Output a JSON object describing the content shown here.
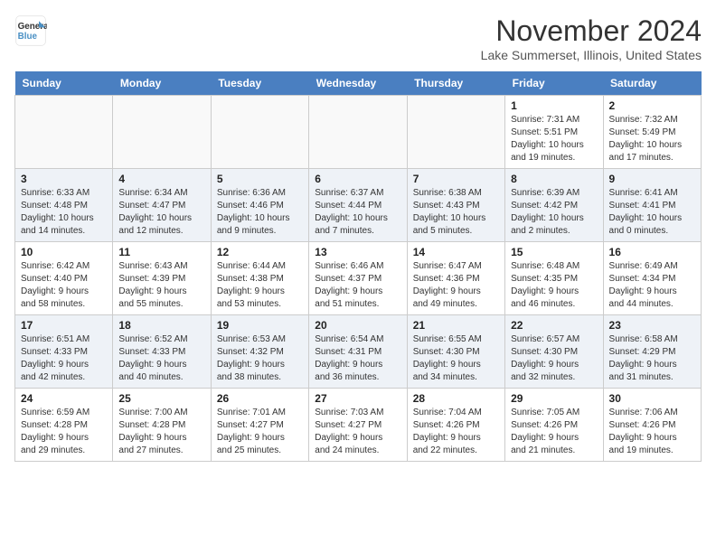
{
  "header": {
    "logo_line1": "General",
    "logo_line2": "Blue",
    "month_title": "November 2024",
    "location": "Lake Summerset, Illinois, United States"
  },
  "weekdays": [
    "Sunday",
    "Monday",
    "Tuesday",
    "Wednesday",
    "Thursday",
    "Friday",
    "Saturday"
  ],
  "weeks": [
    [
      {
        "day": "",
        "info": ""
      },
      {
        "day": "",
        "info": ""
      },
      {
        "day": "",
        "info": ""
      },
      {
        "day": "",
        "info": ""
      },
      {
        "day": "",
        "info": ""
      },
      {
        "day": "1",
        "info": "Sunrise: 7:31 AM\nSunset: 5:51 PM\nDaylight: 10 hours\nand 19 minutes."
      },
      {
        "day": "2",
        "info": "Sunrise: 7:32 AM\nSunset: 5:49 PM\nDaylight: 10 hours\nand 17 minutes."
      }
    ],
    [
      {
        "day": "3",
        "info": "Sunrise: 6:33 AM\nSunset: 4:48 PM\nDaylight: 10 hours\nand 14 minutes."
      },
      {
        "day": "4",
        "info": "Sunrise: 6:34 AM\nSunset: 4:47 PM\nDaylight: 10 hours\nand 12 minutes."
      },
      {
        "day": "5",
        "info": "Sunrise: 6:36 AM\nSunset: 4:46 PM\nDaylight: 10 hours\nand 9 minutes."
      },
      {
        "day": "6",
        "info": "Sunrise: 6:37 AM\nSunset: 4:44 PM\nDaylight: 10 hours\nand 7 minutes."
      },
      {
        "day": "7",
        "info": "Sunrise: 6:38 AM\nSunset: 4:43 PM\nDaylight: 10 hours\nand 5 minutes."
      },
      {
        "day": "8",
        "info": "Sunrise: 6:39 AM\nSunset: 4:42 PM\nDaylight: 10 hours\nand 2 minutes."
      },
      {
        "day": "9",
        "info": "Sunrise: 6:41 AM\nSunset: 4:41 PM\nDaylight: 10 hours\nand 0 minutes."
      }
    ],
    [
      {
        "day": "10",
        "info": "Sunrise: 6:42 AM\nSunset: 4:40 PM\nDaylight: 9 hours\nand 58 minutes."
      },
      {
        "day": "11",
        "info": "Sunrise: 6:43 AM\nSunset: 4:39 PM\nDaylight: 9 hours\nand 55 minutes."
      },
      {
        "day": "12",
        "info": "Sunrise: 6:44 AM\nSunset: 4:38 PM\nDaylight: 9 hours\nand 53 minutes."
      },
      {
        "day": "13",
        "info": "Sunrise: 6:46 AM\nSunset: 4:37 PM\nDaylight: 9 hours\nand 51 minutes."
      },
      {
        "day": "14",
        "info": "Sunrise: 6:47 AM\nSunset: 4:36 PM\nDaylight: 9 hours\nand 49 minutes."
      },
      {
        "day": "15",
        "info": "Sunrise: 6:48 AM\nSunset: 4:35 PM\nDaylight: 9 hours\nand 46 minutes."
      },
      {
        "day": "16",
        "info": "Sunrise: 6:49 AM\nSunset: 4:34 PM\nDaylight: 9 hours\nand 44 minutes."
      }
    ],
    [
      {
        "day": "17",
        "info": "Sunrise: 6:51 AM\nSunset: 4:33 PM\nDaylight: 9 hours\nand 42 minutes."
      },
      {
        "day": "18",
        "info": "Sunrise: 6:52 AM\nSunset: 4:33 PM\nDaylight: 9 hours\nand 40 minutes."
      },
      {
        "day": "19",
        "info": "Sunrise: 6:53 AM\nSunset: 4:32 PM\nDaylight: 9 hours\nand 38 minutes."
      },
      {
        "day": "20",
        "info": "Sunrise: 6:54 AM\nSunset: 4:31 PM\nDaylight: 9 hours\nand 36 minutes."
      },
      {
        "day": "21",
        "info": "Sunrise: 6:55 AM\nSunset: 4:30 PM\nDaylight: 9 hours\nand 34 minutes."
      },
      {
        "day": "22",
        "info": "Sunrise: 6:57 AM\nSunset: 4:30 PM\nDaylight: 9 hours\nand 32 minutes."
      },
      {
        "day": "23",
        "info": "Sunrise: 6:58 AM\nSunset: 4:29 PM\nDaylight: 9 hours\nand 31 minutes."
      }
    ],
    [
      {
        "day": "24",
        "info": "Sunrise: 6:59 AM\nSunset: 4:28 PM\nDaylight: 9 hours\nand 29 minutes."
      },
      {
        "day": "25",
        "info": "Sunrise: 7:00 AM\nSunset: 4:28 PM\nDaylight: 9 hours\nand 27 minutes."
      },
      {
        "day": "26",
        "info": "Sunrise: 7:01 AM\nSunset: 4:27 PM\nDaylight: 9 hours\nand 25 minutes."
      },
      {
        "day": "27",
        "info": "Sunrise: 7:03 AM\nSunset: 4:27 PM\nDaylight: 9 hours\nand 24 minutes."
      },
      {
        "day": "28",
        "info": "Sunrise: 7:04 AM\nSunset: 4:26 PM\nDaylight: 9 hours\nand 22 minutes."
      },
      {
        "day": "29",
        "info": "Sunrise: 7:05 AM\nSunset: 4:26 PM\nDaylight: 9 hours\nand 21 minutes."
      },
      {
        "day": "30",
        "info": "Sunrise: 7:06 AM\nSunset: 4:26 PM\nDaylight: 9 hours\nand 19 minutes."
      }
    ]
  ]
}
